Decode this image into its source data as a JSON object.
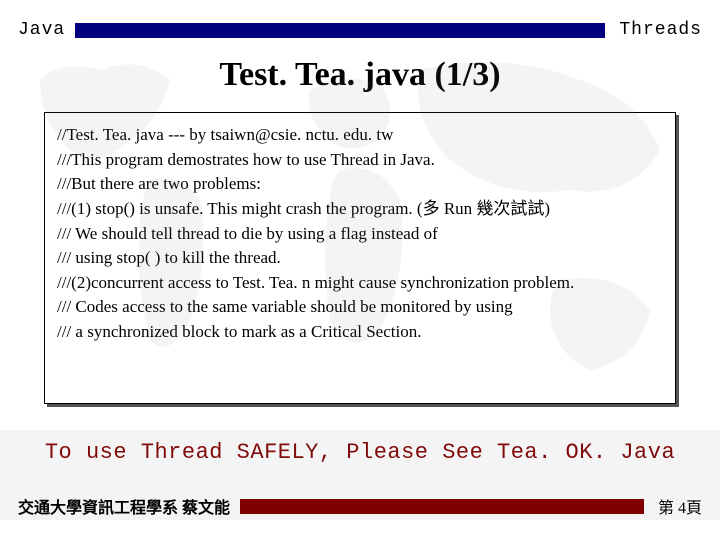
{
  "header": {
    "left": "Java",
    "right": "Threads"
  },
  "title": "Test. Tea. java (1/3)",
  "code": {
    "l1": "//Test. Tea. java --- by tsaiwn@csie. nctu. edu. tw",
    "l2": "///This program demostrates how to use Thread in Java.",
    "l3": "///But there are two problems:",
    "l4": "///(1) stop() is unsafe. This might crash the program. (多 Run 幾次試試)",
    "l5": "///   We should tell thread to die by using a flag instead of",
    "l6": "///    using stop( ) to kill the thread.",
    "l7": "///(2)concurrent access to Test. Tea. n might cause synchronization problem.",
    "l8": "///   Codes access to the same variable should be monitored by using",
    "l9": "///   a synchronized block to mark as a Critical Section."
  },
  "midnote": "To use Thread SAFELY, Please See Tea. OK. Java",
  "footer": {
    "left": "交通大學資訊工程學系 蔡文能",
    "right": "第 4頁"
  }
}
